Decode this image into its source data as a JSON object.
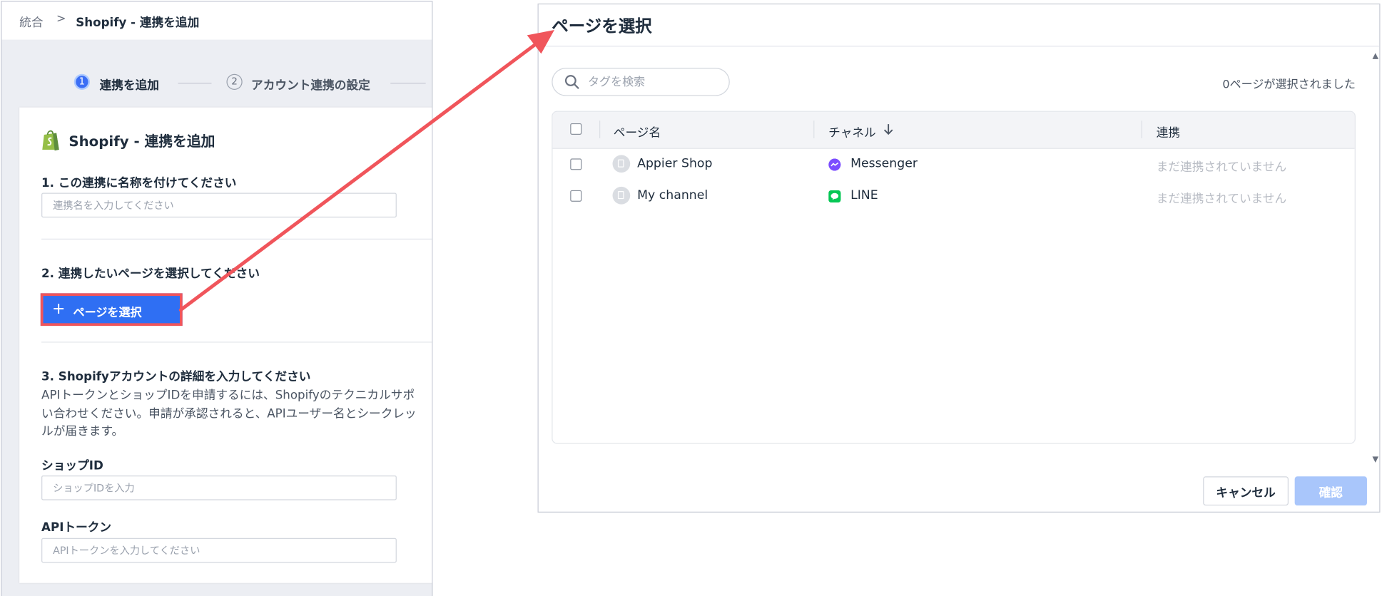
{
  "left": {
    "breadcrumb": {
      "parent": "統合",
      "separator": ">",
      "current": "Shopify - 連携を追加"
    },
    "steps": [
      {
        "number": "1",
        "label": "連携を追加",
        "state": "active"
      },
      {
        "number": "2",
        "label": "アカウント連携の設定",
        "state": "inactive"
      }
    ],
    "card": {
      "icon": "shopify-bag-icon",
      "title": "Shopify - 連携を追加",
      "section1": {
        "title": "1. この連携に名称を付けてください",
        "placeholder": "連携名を入力してください"
      },
      "section2": {
        "title": "2. 連携したいページを選択してください",
        "button_label": "ページを選択",
        "button_icon": "plus-icon"
      },
      "section3": {
        "title": "3. Shopifyアカウントの詳細を入力してください",
        "description_lines": [
          "APIトークンとショップIDを申請するには、Shopifyのテクニカルサポ",
          "い合わせください。申請が承認されると、APIユーザー名とシークレッ",
          "ルが届きます。"
        ]
      },
      "shop_id": {
        "label": "ショップID",
        "placeholder": "ショップIDを入力"
      },
      "api_token": {
        "label": "APIトークン",
        "placeholder": "APIトークンを入力してください"
      }
    }
  },
  "modal": {
    "title": "ページを選択",
    "search": {
      "placeholder": "タグを検索",
      "icon": "search-icon"
    },
    "selected_count": "0ページが選択されました",
    "table": {
      "columns": [
        "ページ名",
        "チャネル",
        "連携"
      ],
      "sort_icon": "arrow-down-icon",
      "rows": [
        {
          "page_name": "Appier Shop",
          "channel": "Messenger",
          "channel_icon": "messenger-icon",
          "status": "まだ連携されていません"
        },
        {
          "page_name": "My channel",
          "channel": "LINE",
          "channel_icon": "line-icon",
          "status": "まだ連携されていません"
        }
      ]
    },
    "buttons": {
      "cancel": "キャンセル",
      "confirm": "確認"
    }
  },
  "colors": {
    "primary": "#2f6ff3",
    "highlight_border": "#f0555b",
    "arrow": "#f0555b",
    "confirm_disabled": "#a9c6fb",
    "shopify_green": "#95bf47",
    "messenger": "#7b4dff",
    "line": "#06c755"
  }
}
